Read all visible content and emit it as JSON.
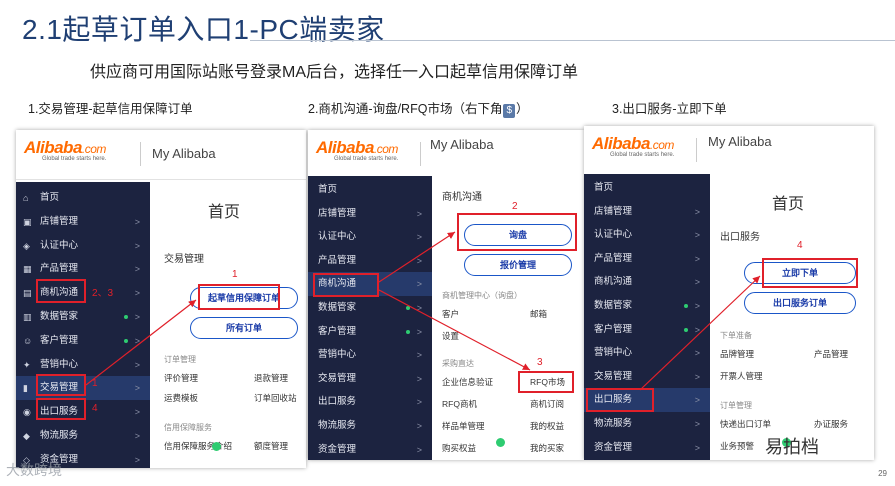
{
  "slide": {
    "title": "2.1起草订单入口1-PC端卖家",
    "subtitle": "供应商可用国际站账号登录MA后台，选择任一入口起草信用保障订单",
    "captions": [
      {
        "pre": "1.交易管理-起草信用保障订单",
        "dollar": "",
        "post": ""
      },
      {
        "pre": "2.商机沟通-询盘/RFQ市场（右下角",
        "dollar": "$",
        "post": "）"
      },
      {
        "pre": "3.出口服务-立即下单",
        "dollar": "",
        "post": ""
      }
    ],
    "page_number": "29",
    "watermark_left": "大数跨境",
    "watermark_right": "易拍档"
  },
  "brand": {
    "logo": "Alibaba",
    "logo_suffix": ".com",
    "tagline": "Global trade starts here.",
    "my_alibaba": "My Alibaba"
  },
  "panel1": {
    "sidebar": [
      {
        "icon": "⌂",
        "label": "首页",
        "arrow": ""
      },
      {
        "icon": "▣",
        "label": "店铺管理",
        "arrow": ">"
      },
      {
        "icon": "◈",
        "label": "认证中心",
        "arrow": ">"
      },
      {
        "icon": "▦",
        "label": "产品管理",
        "arrow": ">"
      },
      {
        "icon": "▤",
        "label": "商机沟通",
        "arrow": ">"
      },
      {
        "icon": "▥",
        "label": "数据管家",
        "arrow": ">"
      },
      {
        "icon": "☺",
        "label": "客户管理",
        "arrow": ">"
      },
      {
        "icon": "✦",
        "label": "营销中心",
        "arrow": ">"
      },
      {
        "icon": "▮",
        "label": "交易管理",
        "arrow": ">"
      },
      {
        "icon": "◉",
        "label": "出口服务",
        "arrow": ">"
      },
      {
        "icon": "◆",
        "label": "物流服务",
        "arrow": ">"
      },
      {
        "icon": "◇",
        "label": "资金管理",
        "arrow": ">"
      }
    ],
    "page_title": "首页",
    "section_title": "交易管理",
    "btn_primary": "起草信用保障订单",
    "btn_secondary": "所有订单",
    "group1": "订单管理",
    "links1": [
      "评价管理",
      "退款管理",
      "运费模板",
      "订单回收站"
    ],
    "group2": "信用保障服务",
    "links2": [
      "信用保障服务介绍",
      "额度管理"
    ],
    "annotations": [
      "1",
      "2、3",
      "1",
      "4"
    ]
  },
  "panel2": {
    "sidebar": [
      {
        "label": "首页",
        "arrow": ""
      },
      {
        "label": "店铺管理",
        "arrow": ">"
      },
      {
        "label": "认证中心",
        "arrow": ">"
      },
      {
        "label": "产品管理",
        "arrow": ">"
      },
      {
        "label": "商机沟通",
        "arrow": ">"
      },
      {
        "label": "数据管家",
        "arrow": ">"
      },
      {
        "label": "客户管理",
        "arrow": ">"
      },
      {
        "label": "营销中心",
        "arrow": ">"
      },
      {
        "label": "交易管理",
        "arrow": ">"
      },
      {
        "label": "出口服务",
        "arrow": ">"
      },
      {
        "label": "物流服务",
        "arrow": ">"
      },
      {
        "label": "资金管理",
        "arrow": ">"
      }
    ],
    "section_title": "商机沟通",
    "btn_primary": "询盘",
    "btn_secondary": "报价管理",
    "group1": "商机管理中心（询盘）",
    "links1": [
      "客户",
      "邮箱",
      "设置"
    ],
    "group2": "采购直达",
    "links2": [
      "企业信息验证",
      "RFQ市场",
      "RFQ商机",
      "商机订阅",
      "样品单管理",
      "我的权益",
      "购买权益",
      "我的买家"
    ],
    "annotations": [
      "2",
      "3"
    ]
  },
  "panel3": {
    "sidebar": [
      {
        "label": "首页",
        "arrow": ""
      },
      {
        "label": "店铺管理",
        "arrow": ">"
      },
      {
        "label": "认证中心",
        "arrow": ">"
      },
      {
        "label": "产品管理",
        "arrow": ">"
      },
      {
        "label": "商机沟通",
        "arrow": ">"
      },
      {
        "label": "数据管家",
        "arrow": ">"
      },
      {
        "label": "客户管理",
        "arrow": ">"
      },
      {
        "label": "营销中心",
        "arrow": ">"
      },
      {
        "label": "交易管理",
        "arrow": ">"
      },
      {
        "label": "出口服务",
        "arrow": ">"
      },
      {
        "label": "物流服务",
        "arrow": ">"
      },
      {
        "label": "资金管理",
        "arrow": ">"
      }
    ],
    "page_title": "首页",
    "section_title": "出口服务",
    "btn_primary": "立即下单",
    "btn_secondary": "出口服务订单",
    "group1": "下单准备",
    "links1": [
      "品牌管理",
      "产品管理",
      "开票人管理"
    ],
    "group2": "订单管理",
    "links2": [
      "快递出口订单",
      "办证服务",
      "业务预警"
    ],
    "annotations": [
      "4"
    ]
  },
  "colors": {
    "sidebar_bg": "#1c2340",
    "sidebar_active": "#263a6b",
    "accent": "#1a56c8",
    "highlight": "#e0202a",
    "title": "#1f3f73",
    "logo": "#ff6a00"
  }
}
